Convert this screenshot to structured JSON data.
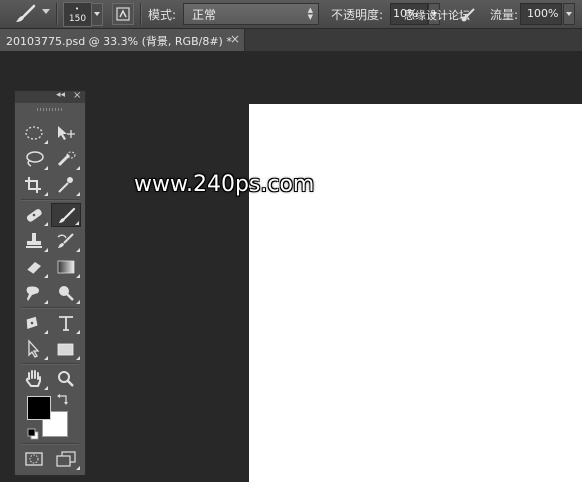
{
  "options_bar": {
    "brush_size": "150",
    "brush_size_dot": "•",
    "mode_label": "模式:",
    "mode_value": "正常",
    "opacity_label": "不透明度:",
    "opacity_value": "10%",
    "flow_label": "流量:",
    "flow_value": "100%",
    "overlay_text": "思缘设计论坛"
  },
  "document_tab": {
    "title": "20103775.psd @ 33.3% (背景, RGB/8#) *",
    "close": "×"
  },
  "canvas": {
    "watermark": "www.240ps.com",
    "background_color": "#282828",
    "document_color": "#ffffff"
  },
  "toolbox": {
    "collapse": "◂◂",
    "close": "×",
    "foreground_color": "#000000",
    "background_color": "#ffffff"
  }
}
